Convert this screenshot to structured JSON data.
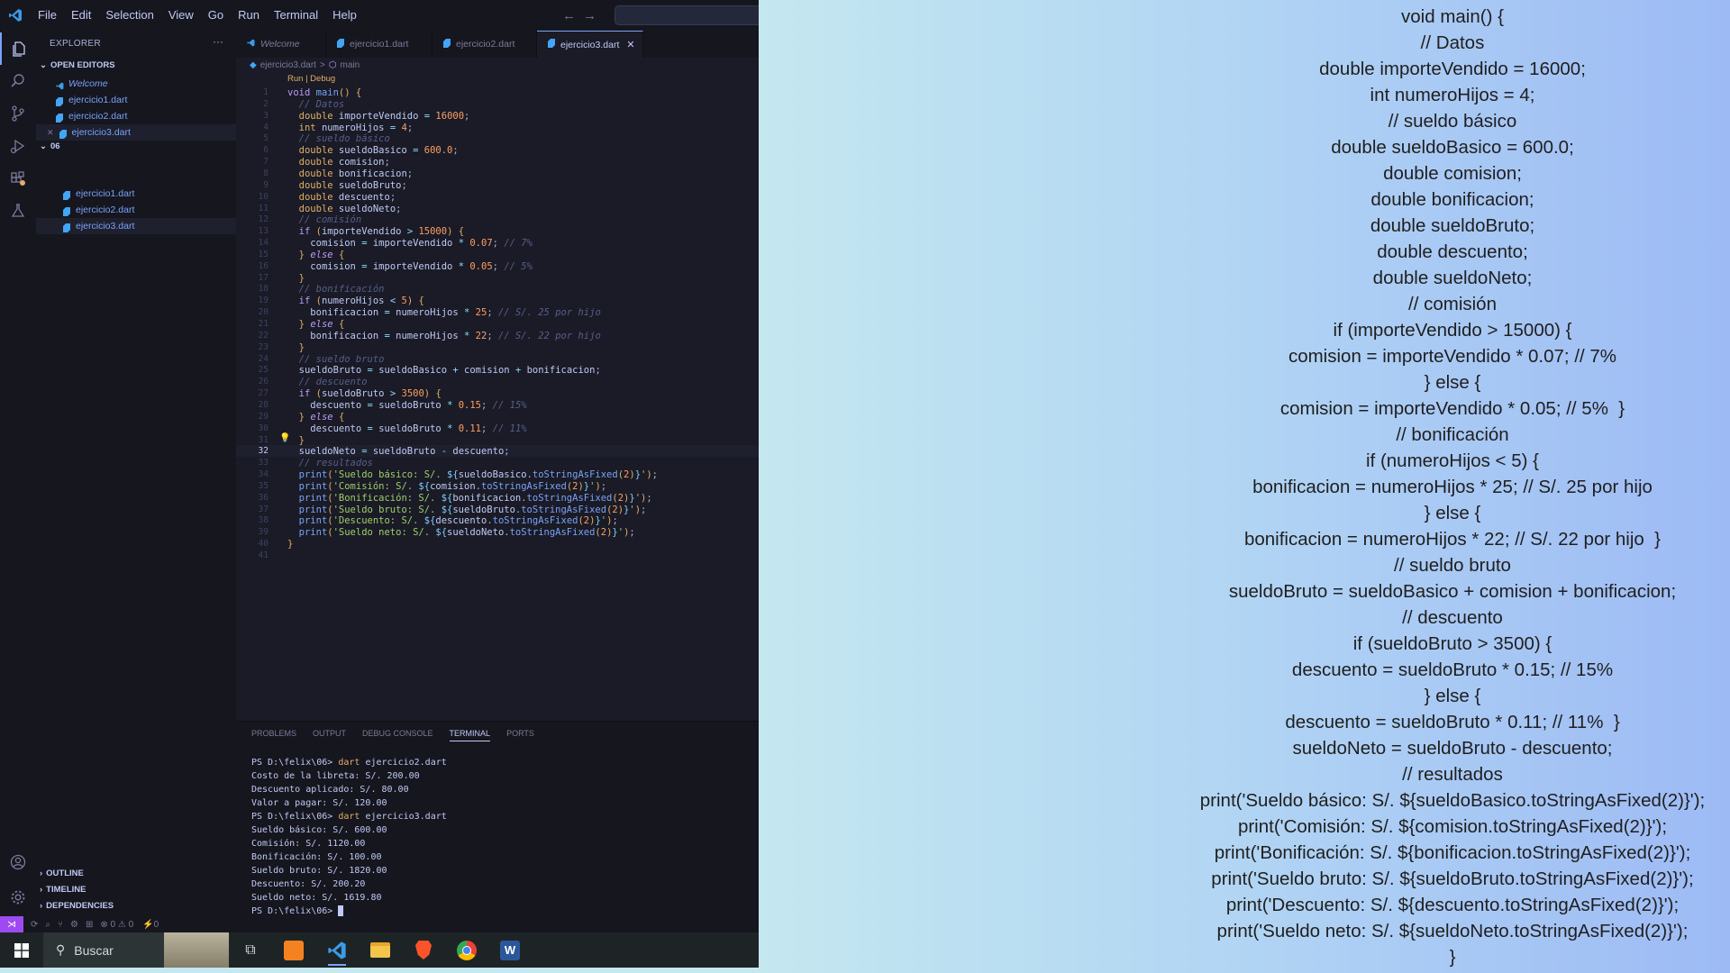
{
  "menu": [
    "File",
    "Edit",
    "Selection",
    "View",
    "Go",
    "Run",
    "Terminal",
    "Help"
  ],
  "sidebar": {
    "title": "EXPLORER",
    "open_editors_label": "OPEN EDITORS",
    "open_editors": [
      {
        "name": "Welcome",
        "icon": "vscode-icon"
      },
      {
        "name": "ejercicio1.dart",
        "icon": "dart-icon"
      },
      {
        "name": "ejercicio2.dart",
        "icon": "dart-icon"
      },
      {
        "name": "ejercicio3.dart",
        "icon": "dart-icon"
      }
    ],
    "folder_label": "06",
    "folder_files": [
      "ejercicio1.dart",
      "ejercicio2.dart",
      "ejercicio3.dart"
    ],
    "outline_label": "OUTLINE",
    "timeline_label": "TIMELINE",
    "dependencies_label": "DEPENDENCIES"
  },
  "tabs": [
    {
      "label": "Welcome",
      "active": false
    },
    {
      "label": "ejercicio1.dart",
      "active": false
    },
    {
      "label": "ejercicio2.dart",
      "active": false
    },
    {
      "label": "ejercicio3.dart",
      "active": true
    }
  ],
  "breadcrumb": {
    "file": "ejercicio3.dart",
    "separator": ">",
    "symbol": "main"
  },
  "codelens": "Run | Debug",
  "current_line": 32,
  "code_lines": [
    "void main() {",
    "  // Datos",
    "  double importeVendido = 16000;",
    "  int numeroHijos = 4;",
    "  // sueldo básico",
    "  double sueldoBasico = 600.0;",
    "  double comision;",
    "  double bonificacion;",
    "  double sueldoBruto;",
    "  double descuento;",
    "  double sueldoNeto;",
    "  // comisión",
    "  if (importeVendido > 15000) {",
    "    comision = importeVendido * 0.07; // 7%",
    "  } else {",
    "    comision = importeVendido * 0.05; // 5%",
    "  }",
    "  // bonificación",
    "  if (numeroHijos < 5) {",
    "    bonificacion = numeroHijos * 25; // S/. 25 por hijo",
    "  } else {",
    "    bonificacion = numeroHijos * 22; // S/. 22 por hijo",
    "  }",
    "  // sueldo bruto",
    "  sueldoBruto = sueldoBasico + comision + bonificacion;",
    "  // descuento",
    "  if (sueldoBruto > 3500) {",
    "    descuento = sueldoBruto * 0.15; // 15%",
    "  } else {",
    "    descuento = sueldoBruto * 0.11; // 11%",
    "  }",
    "  sueldoNeto = sueldoBruto - descuento;",
    "  // resultados",
    "  print('Sueldo básico: S/. ${sueldoBasico.toStringAsFixed(2)}');",
    "  print('Comisión: S/. ${comision.toStringAsFixed(2)}');",
    "  print('Bonificación: S/. ${bonificacion.toStringAsFixed(2)}');",
    "  print('Sueldo bruto: S/. ${sueldoBruto.toStringAsFixed(2)}');",
    "  print('Descuento: S/. ${descuento.toStringAsFixed(2)}');",
    "  print('Sueldo neto: S/. ${sueldoNeto.toStringAsFixed(2)}');",
    "}",
    ""
  ],
  "panel": {
    "tabs": [
      "PROBLEMS",
      "OUTPUT",
      "DEBUG CONSOLE",
      "TERMINAL",
      "PORTS"
    ],
    "active_tab": "TERMINAL",
    "terminal_lines": [
      "PS D:\\felix\\06> dart ejercicio2.dart",
      "Costo de la libreta: S/. 200.00",
      "Descuento aplicado: S/. 80.00",
      "Valor a pagar: S/. 120.00",
      "PS D:\\felix\\06> dart ejercicio3.dart",
      "Sueldo básico: S/. 600.00",
      "Comisión: S/. 1120.00",
      "Bonificación: S/. 100.00",
      "Sueldo bruto: S/. 1820.00",
      "Descuento: S/. 200.20",
      "Sueldo neto: S/. 1619.80",
      "PS D:\\felix\\06> "
    ]
  },
  "statusbar": {
    "problems": "⊗ 0 ⚠ 0",
    "ports": "⚡0"
  },
  "taskbar": {
    "search_placeholder": "Buscar"
  },
  "slide_lines": [
    "void main() {",
    "// Datos",
    "double importeVendido = 16000;",
    "int numeroHijos = 4;",
    "// sueldo básico",
    "double sueldoBasico = 600.0;",
    "double comision;",
    "double bonificacion;",
    "double sueldoBruto;",
    "double descuento;",
    "double sueldoNeto;",
    "// comisión",
    "if (importeVendido > 15000) {",
    "comision = importeVendido * 0.07; // 7%",
    "} else {",
    "comision = importeVendido * 0.05; // 5%  }",
    "// bonificación",
    "if (numeroHijos < 5) {",
    "bonificacion = numeroHijos * 25; // S/. 25 por hijo",
    "} else {",
    "bonificacion = numeroHijos * 22; // S/. 22 por hijo  }",
    "// sueldo bruto",
    "sueldoBruto = sueldoBasico + comision + bonificacion;",
    "// descuento",
    "if (sueldoBruto > 3500) {",
    "descuento = sueldoBruto * 0.15; // 15%",
    "} else {",
    "descuento = sueldoBruto * 0.11; // 11%  }",
    "sueldoNeto = sueldoBruto - descuento;",
    "// resultados",
    "print('Sueldo básico: S/. ${sueldoBasico.toStringAsFixed(2)}');",
    "print('Comisión: S/. ${comision.toStringAsFixed(2)}');",
    "print('Bonificación: S/. ${bonificacion.toStringAsFixed(2)}');",
    "print('Sueldo bruto: S/. ${sueldoBruto.toStringAsFixed(2)}');",
    "print('Descuento: S/. ${descuento.toStringAsFixed(2)}');",
    "print('Sueldo neto: S/. ${sueldoNeto.toStringAsFixed(2)}');",
    "}"
  ]
}
